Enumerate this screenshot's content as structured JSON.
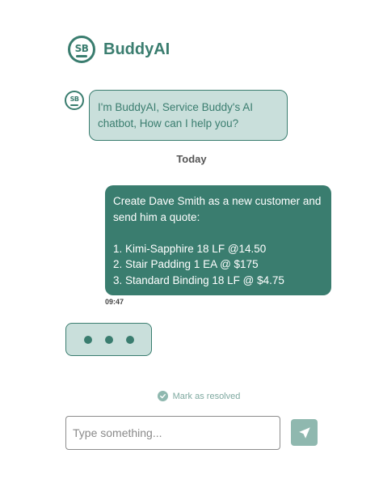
{
  "header": {
    "logo_text": "SB",
    "title": "BuddyAI"
  },
  "conversation": {
    "bot_greeting": "I'm BuddyAI, Service Buddy's AI chatbot, How can I help you?",
    "day_label": "Today",
    "user_message": {
      "lines": [
        "Create Dave Smith as a new customer and send him a quote:",
        "1. Kimi-Sapphire 18 LF @14.50",
        "2. Stair Padding 1 EA @ $175",
        "3. Standard Binding 18 LF @ $4.75"
      ],
      "time": "09:47"
    },
    "typing_indicator_dots": 3
  },
  "resolve": {
    "label": "Mark as resolved"
  },
  "composer": {
    "placeholder": "Type something...",
    "value": ""
  },
  "icons": {
    "logo": "service-buddy-logo",
    "check": "check-circle-icon",
    "send": "paper-plane-icon"
  },
  "colors": {
    "brand": "#3a7d6f",
    "bubble_light": "#c9dfdb",
    "muted": "#8fb8af"
  }
}
